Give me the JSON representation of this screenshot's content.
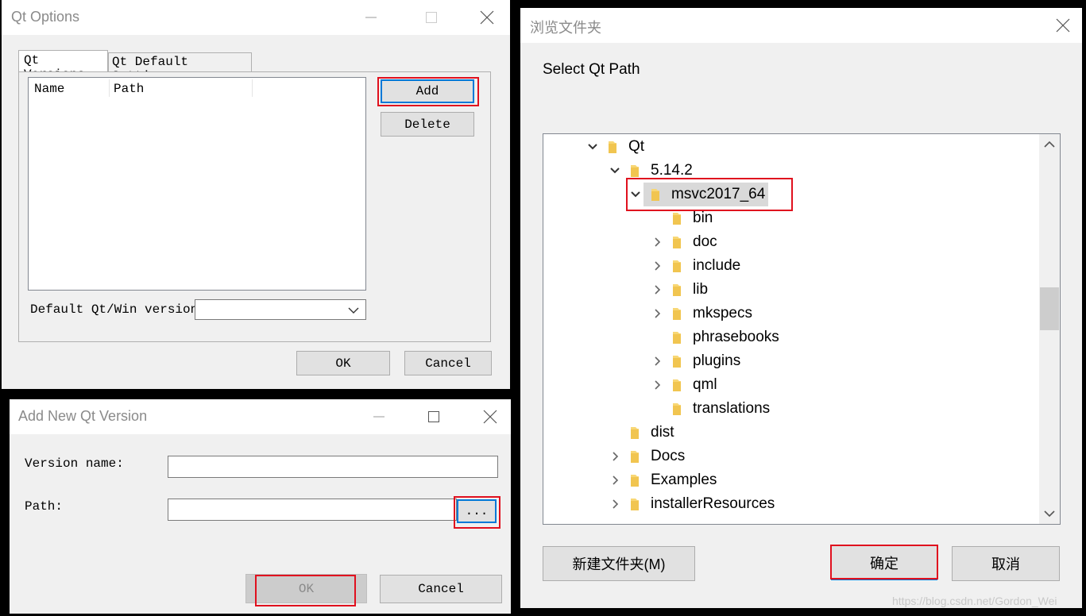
{
  "qt_options": {
    "title": "Qt Options",
    "tabs": [
      {
        "label": "Qt Versions"
      },
      {
        "label": "Qt Default Settings"
      }
    ],
    "table_headers": [
      "Name",
      "Path"
    ],
    "add_label": "Add",
    "delete_label": "Delete",
    "default_version_label": "Default Qt/Win version:",
    "default_version_value": "",
    "ok_label": "OK",
    "cancel_label": "Cancel"
  },
  "add_version": {
    "title": "Add New Qt Version",
    "version_name_label": "Version name:",
    "version_name_value": "",
    "path_label": "Path:",
    "path_value": "",
    "browse_label": "...",
    "ok_label": "OK",
    "cancel_label": "Cancel"
  },
  "browse": {
    "title": "浏览文件夹",
    "prompt": "Select Qt Path",
    "tree": [
      {
        "label": "Qt",
        "expanded": true
      },
      {
        "label": "5.14.2",
        "expanded": true
      },
      {
        "label": "msvc2017_64",
        "expanded": true,
        "selected": true
      },
      {
        "label": "bin",
        "expanded": null
      },
      {
        "label": "doc",
        "expanded": false
      },
      {
        "label": "include",
        "expanded": false
      },
      {
        "label": "lib",
        "expanded": false
      },
      {
        "label": "mkspecs",
        "expanded": false
      },
      {
        "label": "phrasebooks",
        "expanded": null
      },
      {
        "label": "plugins",
        "expanded": false
      },
      {
        "label": "qml",
        "expanded": false
      },
      {
        "label": "translations",
        "expanded": null
      },
      {
        "label": "dist",
        "expanded": null
      },
      {
        "label": "Docs",
        "expanded": false
      },
      {
        "label": "Examples",
        "expanded": false
      },
      {
        "label": "installerResources",
        "expanded": false
      }
    ],
    "new_folder_label": "新建文件夹(M)",
    "ok_label": "确定",
    "cancel_label": "取消"
  },
  "watermark": "https://blog.csdn.net/Gordon_Wei",
  "colors": {
    "highlight": "#e0101e",
    "folder": "#f8d775",
    "selection": "#d9d9d9",
    "focus": "#0078d7"
  }
}
